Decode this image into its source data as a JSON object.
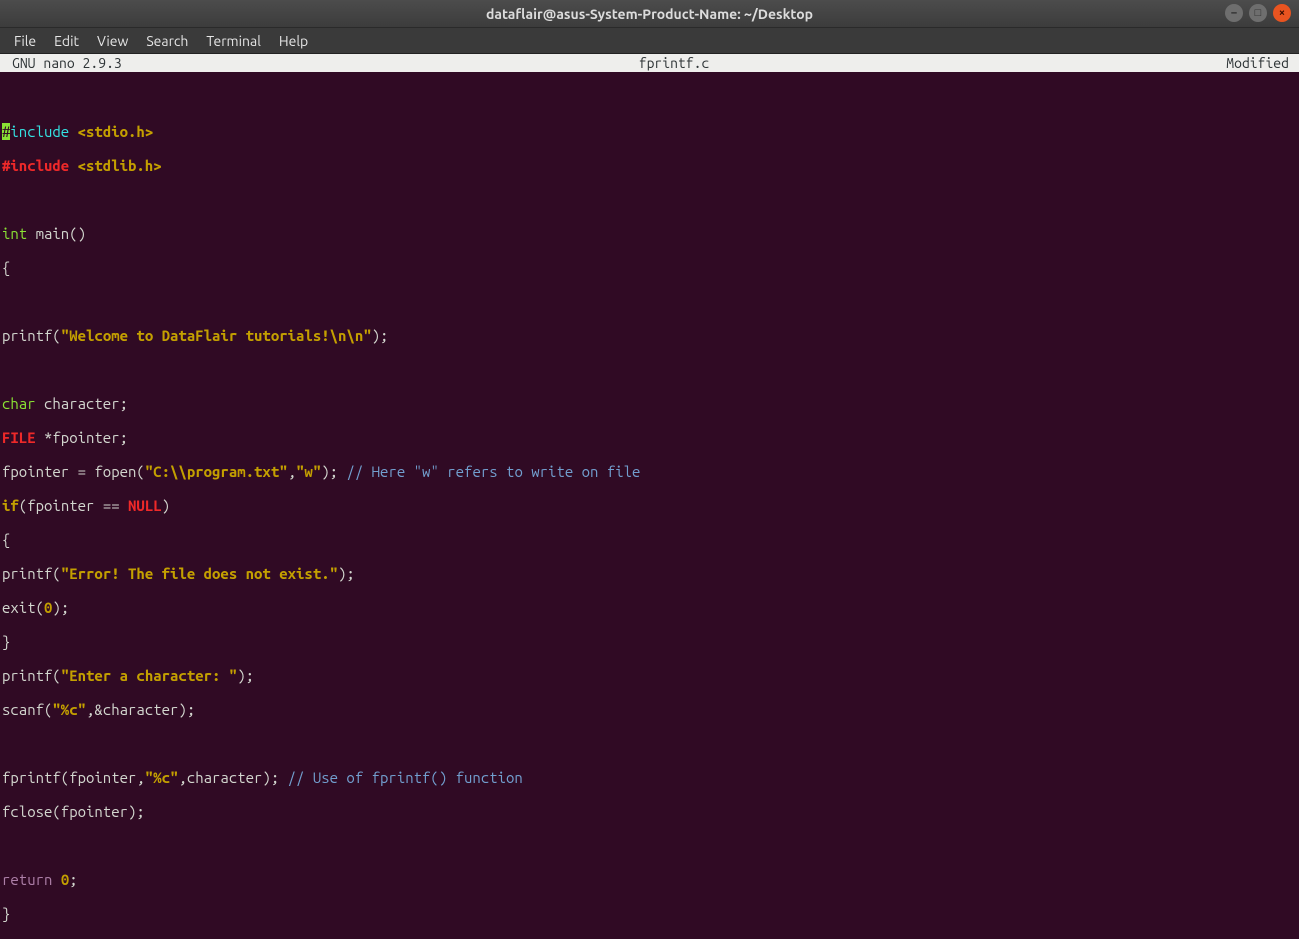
{
  "window": {
    "title": "dataflair@asus-System-Product-Name: ~/Desktop"
  },
  "menubar": {
    "items": [
      "File",
      "Edit",
      "View",
      "Search",
      "Terminal",
      "Help"
    ]
  },
  "nano": {
    "program": "GNU nano 2.9.3",
    "filename": "fprintf.c",
    "status": "Modified"
  },
  "code": {
    "l1_cursor": "#",
    "l1_pre": "include",
    "l1_hdr": " <stdio.h>",
    "l2_pre": "#include",
    "l2_hdr": " <stdlib.h>",
    "l4_type": "int",
    "l4_rest": " main()",
    "l5": "{",
    "l7_a": "printf(",
    "l7_str": "\"Welcome to DataFlair tutorials!\\n\\n\"",
    "l7_b": ");",
    "l9_type": "char",
    "l9_rest": " character;",
    "l10_type": "FILE",
    "l10_rest": " *fpointer;",
    "l11_a": "fpointer = fopen(",
    "l11_s1": "\"C:\\\\program.txt\"",
    "l11_b": ",",
    "l11_s2": "\"w\"",
    "l11_c": "); ",
    "l11_cmt": "// Here \"w\" refers to write on file",
    "l12_if": "if",
    "l12_a": "(fpointer == ",
    "l12_null": "NULL",
    "l12_b": ")",
    "l13": "{",
    "l14_a": "printf(",
    "l14_str": "\"Error! The file does not exist.\"",
    "l14_b": ");",
    "l15_a": "exit(",
    "l15_num": "0",
    "l15_b": ");",
    "l16": "}",
    "l17_a": "printf(",
    "l17_str": "\"Enter a character: \"",
    "l17_b": ");",
    "l18_a": "scanf(",
    "l18_str": "\"%c\"",
    "l18_b": ",&character);",
    "l20_a": "fprintf(fpointer,",
    "l20_str": "\"%c\"",
    "l20_b": ",character); ",
    "l20_cmt": "// Use of fprintf() function",
    "l21": "fclose(fpointer);",
    "l23_ret": "return",
    "l23_sp": " ",
    "l23_num": "0",
    "l23_b": ";",
    "l24": "}"
  }
}
